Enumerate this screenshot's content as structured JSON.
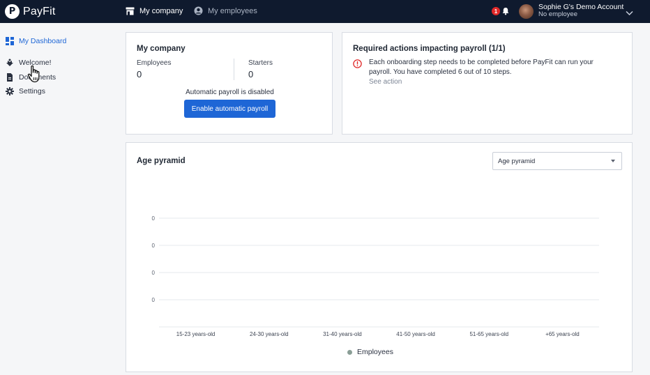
{
  "header": {
    "logo_text": "PayFit",
    "nav": [
      {
        "label": "My company",
        "icon": "store-icon"
      },
      {
        "label": "My employees",
        "icon": "user-circle-icon"
      }
    ],
    "notification_count": "1",
    "account_name": "Sophie G's Demo Account",
    "account_sub": "No employee"
  },
  "sidebar": {
    "items": [
      {
        "label": "My Dashboard",
        "icon": "dashboard-icon",
        "active": true
      },
      {
        "label": "Welcome!",
        "icon": "welcome-icon"
      },
      {
        "label": "Documents",
        "icon": "document-icon"
      },
      {
        "label": "Settings",
        "icon": "gear-icon"
      }
    ]
  },
  "company_card": {
    "title": "My company",
    "employees_label": "Employees",
    "employees_value": "0",
    "starters_label": "Starters",
    "starters_value": "0",
    "auto_payroll_text": "Automatic payroll is disabled",
    "enable_button": "Enable automatic payroll"
  },
  "actions_card": {
    "title": "Required actions impacting payroll (1/1)",
    "message": "Each onboarding step needs to be completed before PayFit can run your payroll. You have completed 6 out of 10 steps.",
    "link": "See action"
  },
  "pyramid_card": {
    "title": "Age pyramid",
    "select_value": "Age pyramid"
  },
  "chart_data": {
    "type": "bar",
    "categories": [
      "15-23 years-old",
      "24-30 years-old",
      "31-40 years-old",
      "41-50 years-old",
      "51-65 years-old",
      "+65 years-old"
    ],
    "series": [
      {
        "name": "Employees",
        "values": [
          0,
          0,
          0,
          0,
          0,
          0
        ]
      }
    ],
    "y_ticks": [
      "0",
      "0",
      "0",
      "0"
    ],
    "legend": "bottom",
    "grid": true,
    "colors": {
      "series": "#8a9e96",
      "grid": "#e6e8ec"
    }
  },
  "colors": {
    "primary": "#1e66d6",
    "topbar": "#0f1a2e",
    "alert": "#e02828"
  }
}
